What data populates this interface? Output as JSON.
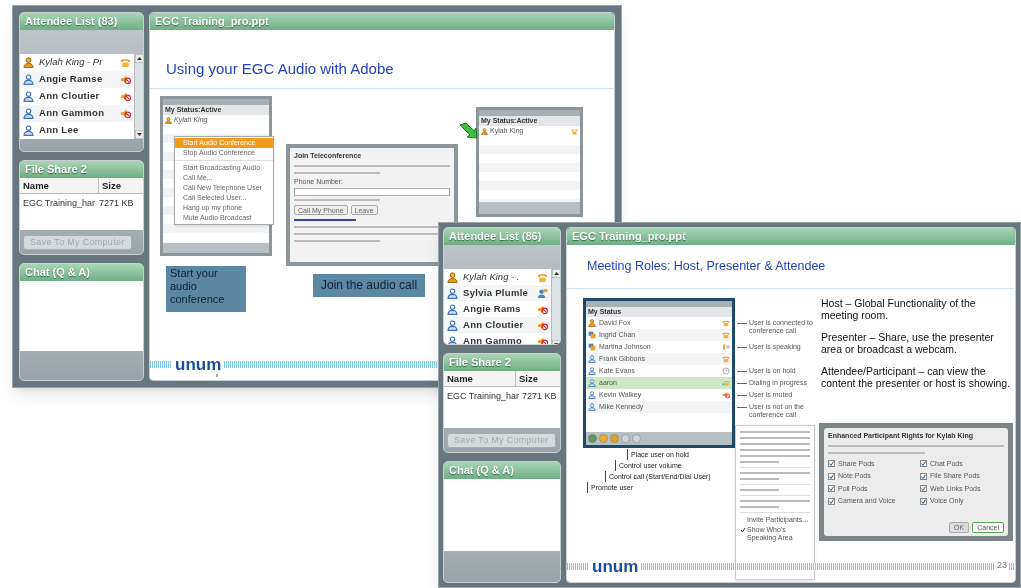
{
  "windows": [
    {
      "attendee_panel": {
        "title": "Attendee List (83)",
        "attendees": [
          {
            "name": "Kylah King - Pr",
            "host": true,
            "kind": "phone"
          },
          {
            "name": "Angie Ramse",
            "host": false,
            "kind": "muted"
          },
          {
            "name": "Ann Cloutier",
            "host": false,
            "kind": "muted"
          },
          {
            "name": "Ann Gammon",
            "host": false,
            "kind": "muted"
          },
          {
            "name": "Ann Lee",
            "host": false,
            "kind": "none"
          }
        ]
      },
      "file_share": {
        "title": "File Share 2",
        "columns": [
          "Name",
          "Size"
        ],
        "rows": [
          [
            "EGC Training_har",
            "7271 KB"
          ]
        ],
        "button": {
          "label": "Save To My Computer",
          "disabled": true
        }
      },
      "chat": {
        "title": "Chat (Q & A)"
      },
      "slide": {
        "kind": "audio",
        "tab": "EGC Training_pro.ppt",
        "heading": "Using your EGC Audio with Adobe",
        "menu_shot": {
          "status": "My Status:Active",
          "user": "Kylah King",
          "menu": [
            {
              "label": "Start Audio Conference",
              "selected": true
            },
            {
              "label": "Stop Audio Conference",
              "selected": false
            },
            {
              "label": "Start Broadcasting Audio",
              "selected": false
            },
            {
              "label": "Call Me...",
              "selected": false
            },
            {
              "label": "Call New Telephone User",
              "selected": false
            },
            {
              "label": "Call Selected User...",
              "selected": false
            },
            {
              "label": "Hang up my phone",
              "selected": false
            },
            {
              "label": "Mute Audio Broadcast",
              "selected": false
            }
          ]
        },
        "join_dialog": {
          "title": "Join Teleconference",
          "field_label": "Phone Number:",
          "buttons": [
            "Call My Phone",
            "Leave"
          ]
        },
        "participants_shot": {
          "status": "My Status:Active",
          "user": "Kylah King"
        },
        "callouts": [
          "Start your audio conference",
          "Join the audio call"
        ],
        "logo": "unum"
      }
    },
    {
      "attendee_panel": {
        "title": "Attendee List (86)",
        "attendees": [
          {
            "name": "Kylah King - .",
            "host": true,
            "kind": "phone"
          },
          {
            "name": "Sylvia Plumle",
            "host": false,
            "kind": "webcam"
          },
          {
            "name": "Angie Rams",
            "host": false,
            "kind": "muted"
          },
          {
            "name": "Ann Cloutier",
            "host": false,
            "kind": "muted"
          },
          {
            "name": "Ann Gammo",
            "host": false,
            "kind": "muted"
          }
        ]
      },
      "file_share": {
        "title": "File Share 2",
        "columns": [
          "Name",
          "Size"
        ],
        "rows": [
          [
            "EGC Training_har",
            "7271 KB"
          ]
        ],
        "button": {
          "label": "Save To My Computer",
          "disabled": true
        }
      },
      "chat": {
        "title": "Chat (Q & A)"
      },
      "slide": {
        "kind": "roles",
        "tab": "EGC Training_pro.ppt",
        "heading": "Meeting Roles: Host, Presenter & Attendee",
        "paragraphs": [
          "Host – Global Functionality of the meeting room.",
          "Presenter – Share, use the presenter area or broadcast a webcam.",
          "Attendee/Participant – can view the content the presenter or host is showing."
        ],
        "list_shot": {
          "status": "My Status",
          "users": [
            {
              "name": "David Fox",
              "host": true,
              "presenter": false,
              "kind": "phone",
              "selected": false,
              "note": "User is connected to conference call"
            },
            {
              "name": "Ingrid Chan",
              "host": false,
              "presenter": true,
              "kind": "phone",
              "selected": false
            },
            {
              "name": "Martina Johnson",
              "host": false,
              "presenter": true,
              "kind": "speaking",
              "selected": false,
              "note": "User is speaking"
            },
            {
              "name": "Frank Gibbons",
              "host": false,
              "presenter": false,
              "kind": "phone",
              "selected": false
            },
            {
              "name": "Kate Evans",
              "host": false,
              "presenter": false,
              "kind": "hold",
              "selected": false,
              "note": "User is on hold"
            },
            {
              "name": "aaron",
              "host": false,
              "presenter": false,
              "kind": "dialing",
              "selected": true,
              "note": "Dialing in progress"
            },
            {
              "name": "Kevin Walkey",
              "host": false,
              "presenter": false,
              "kind": "muted",
              "selected": false,
              "note": "User is muted"
            },
            {
              "name": "Mike Kennedy",
              "host": false,
              "presenter": false,
              "kind": "none",
              "selected": false,
              "note": "User is not on the conference call"
            }
          ],
          "toolbar_notes": [
            "Place user on hold",
            "Control user volume",
            "Control call (Start/End/Dial User)",
            "Promote user"
          ]
        },
        "context_menu": [
          {
            "label": "Invite Participants...",
            "checked": false
          },
          {
            "label": "Show Who's Speaking Area",
            "checked": true
          }
        ],
        "rights_dialog": {
          "title": "Enhanced Participant Rights for Kylah King",
          "options": [
            {
              "label": "Share Pods",
              "checked": true
            },
            {
              "label": "Chat Pods",
              "checked": true
            },
            {
              "label": "Note Pods",
              "checked": true
            },
            {
              "label": "File Share Pods",
              "checked": true
            },
            {
              "label": "Poll Pods",
              "checked": true
            },
            {
              "label": "Web Links Pods",
              "checked": true
            },
            {
              "label": "Camera and Voice",
              "checked": true
            },
            {
              "label": "Voice Only",
              "checked": true
            }
          ],
          "buttons": [
            "OK",
            "Cancel"
          ]
        },
        "logo": "unum",
        "page": "23"
      }
    }
  ]
}
